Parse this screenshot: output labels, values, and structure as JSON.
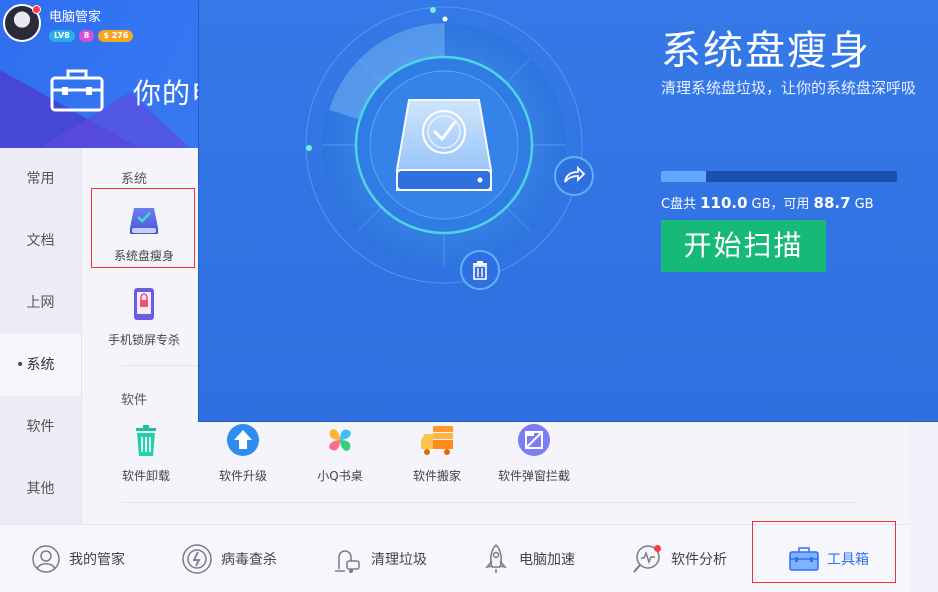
{
  "header": {
    "username": "电脑管家",
    "badges": {
      "level": "LV8",
      "vip": "8",
      "coins": "$ 276"
    },
    "title": "你的电"
  },
  "sidebar": {
    "items": [
      {
        "label": "常用"
      },
      {
        "label": "文档"
      },
      {
        "label": "上网"
      },
      {
        "label": "系统",
        "active": true
      },
      {
        "label": "软件"
      },
      {
        "label": "其他"
      }
    ]
  },
  "content": {
    "system_section": "系统",
    "system_tools": [
      {
        "label": "系统盘瘦身",
        "icon": "disk-slim-icon"
      },
      {
        "label": "手机锁屏专杀",
        "icon": "phone-lock-icon"
      }
    ],
    "software_section": "软件",
    "software_tools": [
      {
        "label": "软件卸载",
        "icon": "trash-icon"
      },
      {
        "label": "软件升级",
        "icon": "upgrade-icon"
      },
      {
        "label": "小Q书桌",
        "icon": "pinwheel-icon"
      },
      {
        "label": "软件搬家",
        "icon": "truck-icon"
      },
      {
        "label": "软件弹窗拦截",
        "icon": "popup-block-icon"
      }
    ]
  },
  "bottom_nav": [
    {
      "label": "我的管家",
      "icon": "butler-icon"
    },
    {
      "label": "病毒查杀",
      "icon": "virus-scan-icon"
    },
    {
      "label": "清理垃圾",
      "icon": "vacuum-icon"
    },
    {
      "label": "电脑加速",
      "icon": "rocket-icon"
    },
    {
      "label": "软件分析",
      "icon": "analysis-icon"
    },
    {
      "label": "工具箱",
      "icon": "toolbox-icon",
      "active": true
    }
  ],
  "popup": {
    "title": "系统盘瘦身",
    "subtitle": "清理系统盘垃圾，让你的系统盘深呼吸",
    "disk_total_prefix": "C盘共",
    "disk_total": "110.0",
    "unit": "GB",
    "disk_free_prefix": "，可用",
    "disk_free": "88.7",
    "usage_fraction": 0.19,
    "scan_button": "开始扫描"
  },
  "colors": {
    "header_blue": "#2f6ff0",
    "popup_blue": "#3579e8",
    "scan_green": "#17b978",
    "highlight_red": "#e33333"
  }
}
